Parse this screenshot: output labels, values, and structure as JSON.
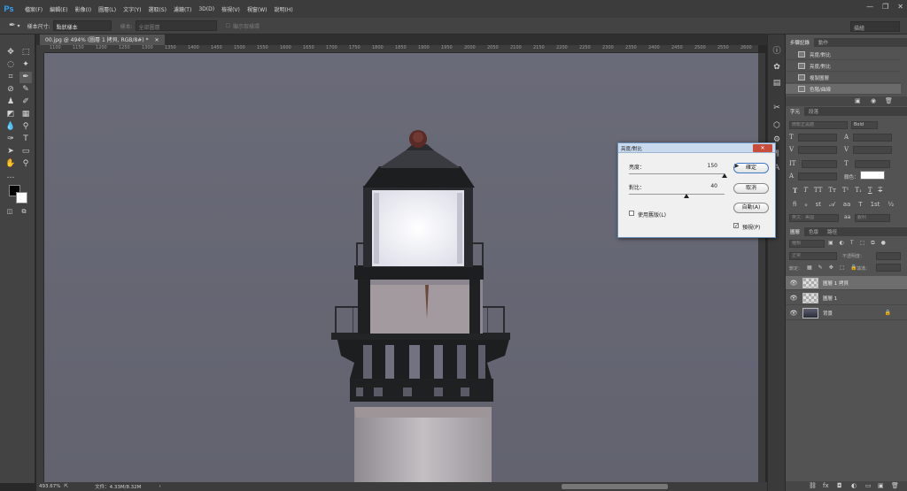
{
  "app": {
    "logo": "Ps"
  },
  "menu": [
    "檔案(F)",
    "編輯(E)",
    "影像(I)",
    "圖層(L)",
    "文字(Y)",
    "選取(S)",
    "濾鏡(T)",
    "3D(D)",
    "檢視(V)",
    "視窗(W)",
    "說明(H)"
  ],
  "options": {
    "sample_size_label": "樣本尺寸:",
    "sample_size_value": "點狀樣本",
    "sample_label": "樣本:",
    "sample_value": "全部圖層",
    "ring_label": "顯示取樣環",
    "workspace": "描繪"
  },
  "document": {
    "tab_title": "00.jpg @ 494% (圖層 1 拷貝, RGB/8#) *",
    "ruler_ticks": [
      "1100",
      "1150",
      "1200",
      "1250",
      "1300",
      "1350",
      "1400",
      "1450",
      "1500",
      "1550",
      "1600",
      "1650",
      "1700",
      "1750",
      "1800",
      "1850",
      "1900",
      "1950",
      "2000",
      "2050",
      "2100",
      "2150",
      "2200",
      "2250",
      "2300",
      "2350",
      "2400",
      "2450",
      "2500",
      "2550",
      "2600"
    ]
  },
  "status": {
    "zoom": "493.67%",
    "file_info": "文件：4.33M/8.32M"
  },
  "history_panel": {
    "tabs": [
      "步驟記錄",
      "動作"
    ],
    "items": [
      {
        "label": "亮度/對比"
      },
      {
        "label": "亮度/對比"
      },
      {
        "label": "複製圖層"
      },
      {
        "label": "色階/曲線"
      }
    ]
  },
  "character_panel": {
    "tabs": [
      "字元",
      "段落"
    ],
    "font": "微軟正黑體",
    "style": "Bold",
    "color_label": "顏色：",
    "lang": "英文：美國",
    "aa": "銳利"
  },
  "layers_panel": {
    "tabs": [
      "圖層",
      "色版",
      "路徑"
    ],
    "kind": "種類",
    "blend": "正常",
    "opacity_label": "不透明度：",
    "lock_label": "鎖定：",
    "fill_label": "填滿：",
    "layers": [
      {
        "name": "圖層 1 拷貝",
        "selected": true
      },
      {
        "name": "圖層 1",
        "selected": false
      },
      {
        "name": "背景",
        "selected": false
      }
    ]
  },
  "dialog": {
    "title": "亮度/對比",
    "brightness_label": "亮度：",
    "brightness_value": "150",
    "brightness": 150,
    "contrast_label": "對比：",
    "contrast_value": "40",
    "contrast": 40,
    "ok": "確定",
    "cancel": "取消",
    "auto": "自動(A)",
    "legacy_label": "使用舊版(L)",
    "legacy_checked": false,
    "preview_label": "預視(P)",
    "preview_checked": true
  },
  "colors": {
    "sky": "#656673",
    "tower_dark": "#1f2022",
    "lamp": "#f4f5f9"
  }
}
